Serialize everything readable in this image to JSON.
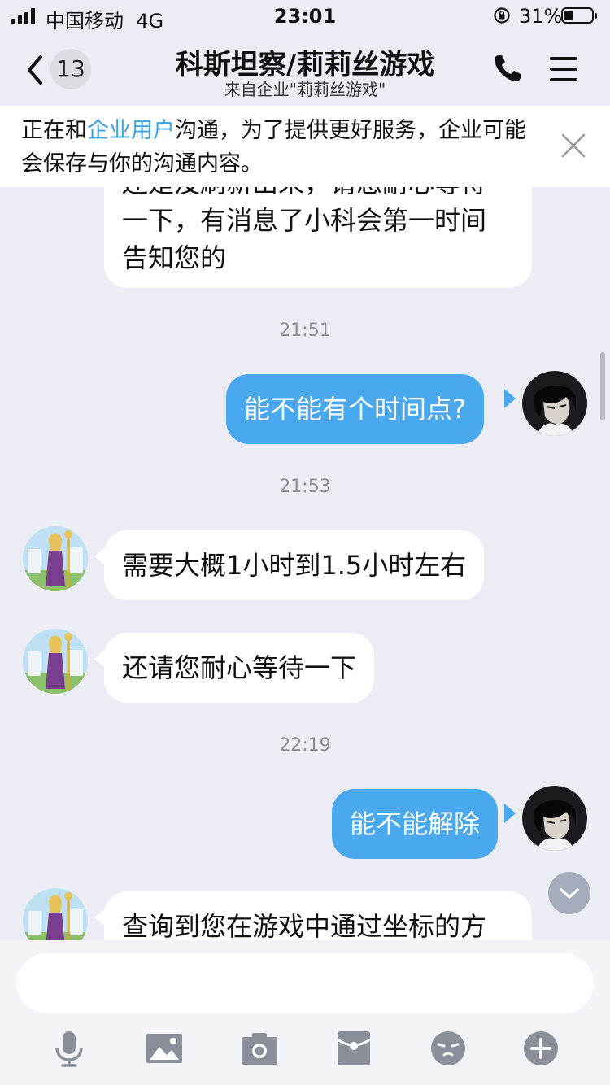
{
  "status_bar": {
    "carrier": "中国移动",
    "network": "4G",
    "time": "23:01",
    "battery": "31%"
  },
  "header": {
    "unread_count": "13",
    "title": "科斯坦察/莉莉丝游戏",
    "subtitle": "来自企业\"莉莉丝游戏\""
  },
  "notice": {
    "prefix": "正在和",
    "highlight": "企业用户",
    "suffix": "沟通，为了提供更好服务，企业可能会保存与你的沟通内容。"
  },
  "messages": [
    {
      "lines": [
        "还是没刷新出来，请您耐心等待",
        "一下，有消息了小科会第一时间",
        "告知您的"
      ]
    },
    {
      "time": "21:51"
    },
    {
      "text": "能不能有个时间点?"
    },
    {
      "time": "21:53"
    },
    {
      "text": "需要大概1小时到1.5小时左右"
    },
    {
      "text": "还请您耐心等待一下"
    },
    {
      "time": "22:19"
    },
    {
      "text": "能不能解除"
    },
    {
      "text": "查询到您在游戏中通过坐标的方"
    }
  ],
  "input": {
    "placeholder": ""
  },
  "toolbar": [
    "microphone-icon",
    "image-icon",
    "camera-icon",
    "red-packet-icon",
    "emoji-icon",
    "plus-icon"
  ]
}
